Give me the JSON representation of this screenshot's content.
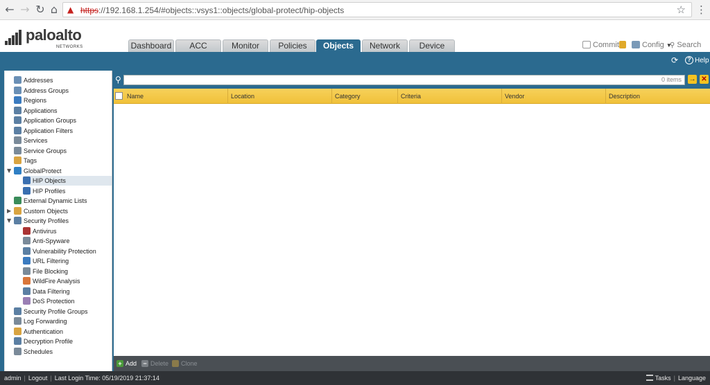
{
  "browser": {
    "url_scheme": "https",
    "url_rest": "://192.168.1.254/#objects::vsys1::objects/global-protect/hip-objects",
    "url_host": "192.168.1.254"
  },
  "header": {
    "logo_text": "paloalto",
    "logo_sub": "NETWORKS",
    "tabs": [
      {
        "label": "Dashboard",
        "active": false
      },
      {
        "label": "ACC",
        "active": false
      },
      {
        "label": "Monitor",
        "active": false
      },
      {
        "label": "Policies",
        "active": false
      },
      {
        "label": "Objects",
        "active": true
      },
      {
        "label": "Network",
        "active": false
      },
      {
        "label": "Device",
        "active": false
      }
    ],
    "commit_label": "Commit",
    "config_label": "Config",
    "search_label": "Search",
    "help_label": "Help"
  },
  "sidebar": {
    "items": [
      {
        "label": "Addresses",
        "icon": "address-icon",
        "color": "#6a8fb5"
      },
      {
        "label": "Address Groups",
        "icon": "address-group-icon",
        "color": "#6a8fb5"
      },
      {
        "label": "Regions",
        "icon": "globe-icon",
        "color": "#3b7bc0"
      },
      {
        "label": "Applications",
        "icon": "application-icon",
        "color": "#5b7fa3"
      },
      {
        "label": "Application Groups",
        "icon": "application-group-icon",
        "color": "#5b7fa3"
      },
      {
        "label": "Application Filters",
        "icon": "filter-icon",
        "color": "#5b7fa3"
      },
      {
        "label": "Services",
        "icon": "wrench-icon",
        "color": "#7a8a99"
      },
      {
        "label": "Service Groups",
        "icon": "service-group-icon",
        "color": "#7a8a99"
      },
      {
        "label": "Tags",
        "icon": "tag-icon",
        "color": "#d9a441"
      },
      {
        "label": "GlobalProtect",
        "icon": "globalprotect-icon",
        "color": "#2f7fc4",
        "expanded": true
      },
      {
        "label": "HIP Objects",
        "icon": "hip-object-icon",
        "color": "#3a6fb0",
        "selected": true
      },
      {
        "label": "HIP Profiles",
        "icon": "hip-profile-icon",
        "color": "#3a6fb0"
      },
      {
        "label": "External Dynamic Lists",
        "icon": "edl-icon",
        "color": "#3a8c5a"
      },
      {
        "label": "Custom Objects",
        "icon": "custom-object-icon",
        "color": "#d9a441",
        "collapsed": true
      },
      {
        "label": "Security Profiles",
        "icon": "security-profile-icon",
        "color": "#5b7fa3",
        "expanded": true
      },
      {
        "label": "Antivirus",
        "icon": "antivirus-icon",
        "color": "#a33"
      },
      {
        "label": "Anti-Spyware",
        "icon": "anti-spyware-icon",
        "color": "#7a8a99"
      },
      {
        "label": "Vulnerability Protection",
        "icon": "vulnerability-icon",
        "color": "#5b7fa3"
      },
      {
        "label": "URL Filtering",
        "icon": "url-filtering-icon",
        "color": "#3b7bc0"
      },
      {
        "label": "File Blocking",
        "icon": "file-blocking-icon",
        "color": "#7a8a99"
      },
      {
        "label": "WildFire Analysis",
        "icon": "wildfire-icon",
        "color": "#d9763a"
      },
      {
        "label": "Data Filtering",
        "icon": "data-filtering-icon",
        "color": "#5b7fa3"
      },
      {
        "label": "DoS Protection",
        "icon": "dos-protection-icon",
        "color": "#9a7fb5"
      },
      {
        "label": "Security Profile Groups",
        "icon": "security-profile-group-icon",
        "color": "#5b7fa3"
      },
      {
        "label": "Log Forwarding",
        "icon": "log-forwarding-icon",
        "color": "#7a8a99"
      },
      {
        "label": "Authentication",
        "icon": "authentication-icon",
        "color": "#d9a441"
      },
      {
        "label": "Decryption Profile",
        "icon": "decryption-icon",
        "color": "#5b7fa3"
      },
      {
        "label": "Schedules",
        "icon": "schedule-icon",
        "color": "#7a8a99"
      }
    ]
  },
  "main": {
    "filter_count": "0 items",
    "columns": [
      "Name",
      "Location",
      "Category",
      "Criteria",
      "Vendor",
      "Description"
    ]
  },
  "toolbar": {
    "add_label": "Add",
    "delete_label": "Delete",
    "clone_label": "Clone"
  },
  "status": {
    "user": "admin",
    "logout": "Logout",
    "last_login": "Last Login Time: 05/19/2019 21:37:14",
    "tasks": "Tasks",
    "language": "Language"
  }
}
